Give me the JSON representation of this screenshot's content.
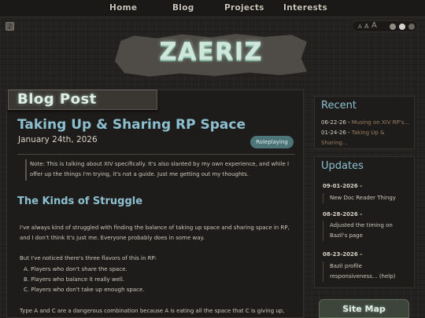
{
  "nav": {
    "items": [
      {
        "label": "Home"
      },
      {
        "label": "Blog"
      },
      {
        "label": "Projects"
      },
      {
        "label": "Interests"
      }
    ]
  },
  "controls": {
    "text_size_labels": [
      "A",
      "A",
      "A"
    ],
    "theme_dots": 3,
    "active_theme_index": 1
  },
  "banner": {
    "title": "ZAERIZ"
  },
  "main": {
    "section_label": "Blog Post",
    "post": {
      "title": "Taking Up & Sharing RP Space",
      "date": "January 24th, 2026",
      "tag": "Roleplaying",
      "note": "Note: This is talking about XIV specifically. It's also slanted by my own experience, and while I offer up the things I'm trying, it's not a guide. Just me getting out my thoughts.",
      "section_heading": "The Kinds of Struggle",
      "paragraph_1": "I've always kind of struggled with finding the balance of taking up space and sharing space in RP, and I don't think it's just me. Everyone probably does in some way.",
      "paragraph_2": "But I've noticed there's three flavors of this in RP:",
      "list": [
        "A. Players who don't share the space.",
        "B. Players who balance it really well.",
        "C. Players who don't take up enough space."
      ],
      "paragraph_3": "Type A and C are a dangerous combination because A is eating all the space that C is giving up, and"
    }
  },
  "sidebar": {
    "recent": {
      "heading": "Recent",
      "items": [
        {
          "date": "06-22-26",
          "sep": " - ",
          "link": "Musing on XIV RP's..."
        },
        {
          "date": "01-24-26",
          "sep": " - ",
          "link": "Taking Up & Sharing..."
        }
      ]
    },
    "updates": {
      "heading": "Updates",
      "items": [
        {
          "date": "09-01-2026 -",
          "text": "New Doc Reader Thingy"
        },
        {
          "date": "08-28-2026 -",
          "text": "Adjusted the timing on Bazil's page"
        },
        {
          "date": "08-23-2026 -",
          "text": "Bazil profile responsiveness... (help)"
        }
      ]
    },
    "sitemap_label": "Site Map"
  },
  "colors": {
    "accent_blue": "#8cc0d0",
    "tag_teal": "#4d7479",
    "banner_glow": "#cfe6dc",
    "link_brown": "#9a7f62"
  },
  "icons": {
    "music": "music-note-icon"
  }
}
